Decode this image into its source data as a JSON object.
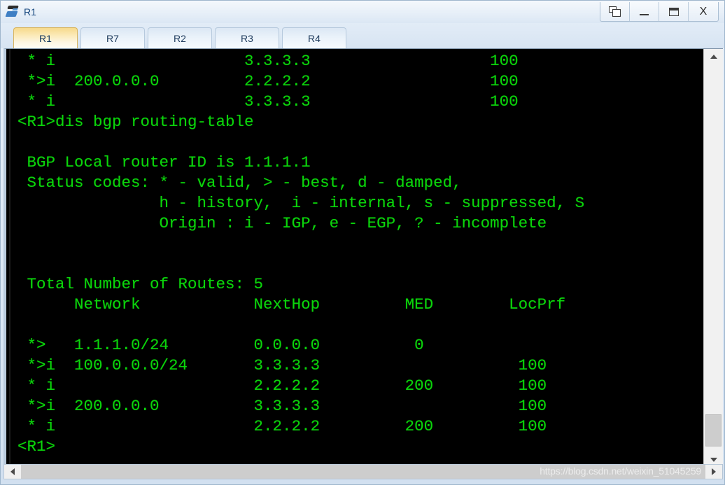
{
  "window": {
    "title": "R1",
    "icon": "router-icon",
    "controls": [
      {
        "name": "restore-button",
        "label": ""
      },
      {
        "name": "minimize-button",
        "label": "_"
      },
      {
        "name": "maximize-button",
        "label": ""
      },
      {
        "name": "close-button",
        "label": "X"
      }
    ]
  },
  "tabs": [
    {
      "label": "R1",
      "active": true
    },
    {
      "label": "R7",
      "active": false
    },
    {
      "label": "R2",
      "active": false
    },
    {
      "label": "R3",
      "active": false
    },
    {
      "label": "R4",
      "active": false
    }
  ],
  "terminal": {
    "foreground_color": "#0bd40b",
    "background_color": "#000000",
    "prompt": "<R1>",
    "command": "dis bgp routing-table",
    "lines": [
      " * i                    3.3.3.3                   100",
      " *>i  200.0.0.0         2.2.2.2                   100",
      " * i                    3.3.3.3                   100",
      "<R1>dis bgp routing-table",
      "",
      " BGP Local router ID is 1.1.1.1",
      " Status codes: * - valid, > - best, d - damped,",
      "               h - history,  i - internal, s - suppressed, S",
      "               Origin : i - IGP, e - EGP, ? - incomplete",
      "",
      "",
      " Total Number of Routes: 5",
      "      Network            NextHop         MED        LocPrf",
      "",
      " *>   1.1.1.0/24         0.0.0.0          0",
      " *>i  100.0.0.0/24       3.3.3.3                     100",
      " * i                     2.2.2.2         200         100",
      " *>i  200.0.0.0          3.3.3.3                     100",
      " * i                     2.2.2.2         200         100",
      "<R1>"
    ],
    "bgp": {
      "local_router_id": "1.1.1.1",
      "status_codes_label": "Status codes:",
      "status_codes": [
        "* - valid",
        "> - best",
        "d - damped",
        "h - history",
        "i - internal",
        "s - suppressed",
        "S"
      ],
      "origin_label": "Origin :",
      "origin_codes": [
        "i - IGP",
        "e - EGP",
        "? - incomplete"
      ],
      "total_routes_label": "Total Number of Routes:",
      "total_routes": 5,
      "columns": [
        "Network",
        "NextHop",
        "MED",
        "LocPrf"
      ],
      "routes": [
        {
          "status": "*>",
          "network": "1.1.1.0/24",
          "nexthop": "0.0.0.0",
          "med": "0",
          "locprf": ""
        },
        {
          "status": "*>i",
          "network": "100.0.0.0/24",
          "nexthop": "3.3.3.3",
          "med": "",
          "locprf": "100"
        },
        {
          "status": "* i",
          "network": "",
          "nexthop": "2.2.2.2",
          "med": "200",
          "locprf": "100"
        },
        {
          "status": "*>i",
          "network": "200.0.0.0",
          "nexthop": "3.3.3.3",
          "med": "",
          "locprf": "100"
        },
        {
          "status": "* i",
          "network": "",
          "nexthop": "2.2.2.2",
          "med": "200",
          "locprf": "100"
        }
      ],
      "scrollback_routes": [
        {
          "status": "* i",
          "network": "",
          "nexthop": "3.3.3.3",
          "locprf": "100"
        },
        {
          "status": "*>i",
          "network": "200.0.0.0",
          "nexthop": "2.2.2.2",
          "locprf": "100"
        },
        {
          "status": "* i",
          "network": "",
          "nexthop": "3.3.3.3",
          "locprf": "100"
        }
      ]
    }
  },
  "scrollbars": {
    "vertical": {
      "up_arrow": "▲",
      "down_arrow": "▼"
    },
    "horizontal": {
      "left_arrow": "◀",
      "right_arrow": "▶"
    }
  },
  "watermark": "https://blog.csdn.net/weixin_51045259"
}
